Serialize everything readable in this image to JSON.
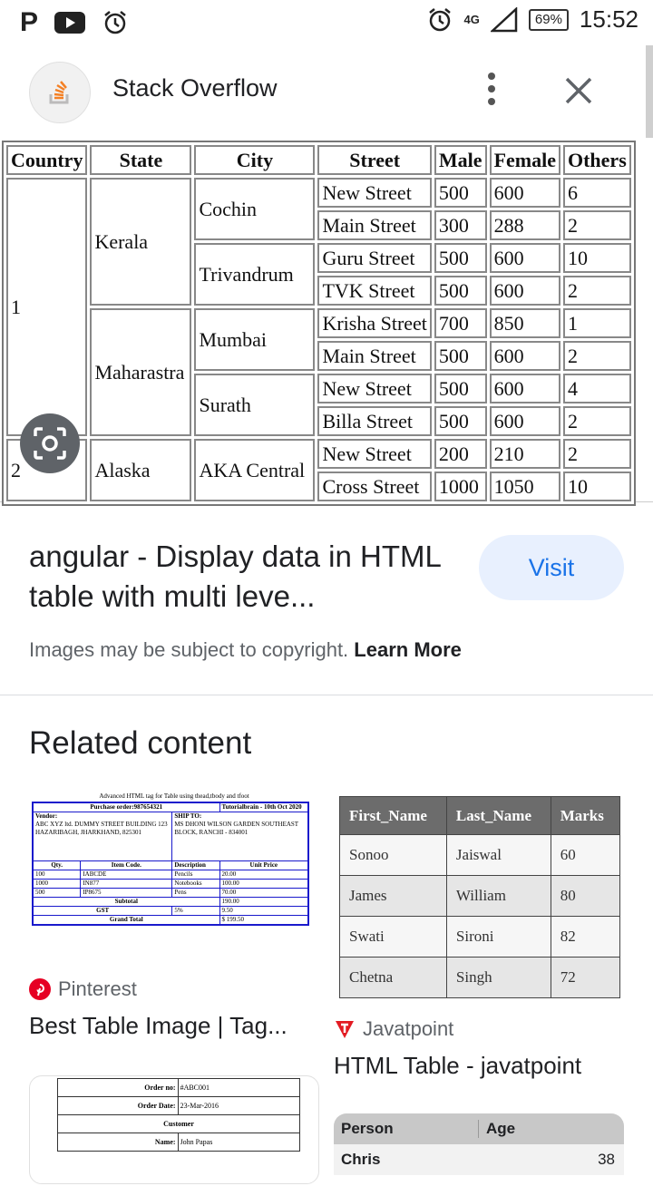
{
  "status_bar": {
    "time": "15:52",
    "battery": "69%",
    "network": "4G"
  },
  "header": {
    "site_name": "Stack Overflow"
  },
  "preview_table": {
    "headers": [
      "Country",
      "State",
      "City",
      "Street",
      "Male",
      "Female",
      "Others"
    ],
    "countries": [
      "1",
      "2"
    ],
    "states": [
      "Kerala",
      "Maharastra",
      "Alaska"
    ],
    "cities": [
      "Cochin",
      "Trivandrum",
      "Mumbai",
      "Surath",
      "AKA Central"
    ],
    "rows": [
      [
        "New Street",
        "500",
        "600",
        "6"
      ],
      [
        "Main Street",
        "300",
        "288",
        "2"
      ],
      [
        "Guru Street",
        "500",
        "600",
        "10"
      ],
      [
        "TVK Street",
        "500",
        "600",
        "2"
      ],
      [
        "Krisha Street",
        "700",
        "850",
        "1"
      ],
      [
        "Main Street",
        "500",
        "600",
        "2"
      ],
      [
        "New Street",
        "500",
        "600",
        "4"
      ],
      [
        "Billa Street",
        "500",
        "600",
        "2"
      ],
      [
        "New Street",
        "200",
        "210",
        "2"
      ],
      [
        "Cross Street",
        "1000",
        "1050",
        "10"
      ]
    ]
  },
  "result": {
    "title": "angular - Display data in HTML table with multi leve...",
    "visit_label": "Visit",
    "copyright": "Images may be subject to copyright.",
    "learn_more": "Learn More"
  },
  "related": {
    "heading": "Related content",
    "items": [
      {
        "source": "Pinterest",
        "title": "Best Table Image | Tag..."
      },
      {
        "source": "Javatpoint",
        "title": "HTML Table - javatpoint"
      }
    ]
  },
  "thumb_po": {
    "caption": "Advanced HTML tag for Table using thead,tbody and tfoot",
    "order": "Purchase order:987654321",
    "brand": "Tutorialbrain - 10th Oct 2020",
    "vendor": "Vendor:",
    "vendor_lines": "ABC XYZ ltd. DUMMY STREET BUILDING 123 HAZARIBAGH, JHARKHAND, 825301",
    "ship": "SHIP TO:",
    "ship_lines": "MS DHONI WILSON GARDEN SOUTHEAST BLOCK, RANCHI - 834001",
    "cols": [
      "Qty.",
      "Item Code.",
      "Description",
      "Unit Price"
    ],
    "items": [
      [
        "100",
        "IABCDE",
        "Pencils",
        "20.00"
      ],
      [
        "1000",
        "IN877",
        "Notebooks",
        "100.00"
      ],
      [
        "500",
        "IP8675",
        "Pens",
        "70.00"
      ]
    ],
    "subtotal": [
      "Subtotal",
      "190.00"
    ],
    "gst": [
      "GST",
      "5%",
      "9.50"
    ],
    "grand": [
      "Grand Total",
      "$ 199.50"
    ]
  },
  "thumb_marks": {
    "headers": [
      "First_Name",
      "Last_Name",
      "Marks"
    ],
    "rows": [
      [
        "Sonoo",
        "Jaiswal",
        "60"
      ],
      [
        "James",
        "William",
        "80"
      ],
      [
        "Swati",
        "Sironi",
        "82"
      ],
      [
        "Chetna",
        "Singh",
        "72"
      ]
    ]
  },
  "thumb_order": {
    "order_no_label": "Order no:",
    "order_no": "#ABC001",
    "order_date_label": "Order Date:",
    "order_date": "23-Mar-2016",
    "customer": "Customer",
    "name_label": "Name:",
    "name": "John Papas"
  },
  "thumb_person": {
    "headers": [
      "Person",
      "Age"
    ],
    "first_row": [
      "Chris",
      "38"
    ]
  }
}
